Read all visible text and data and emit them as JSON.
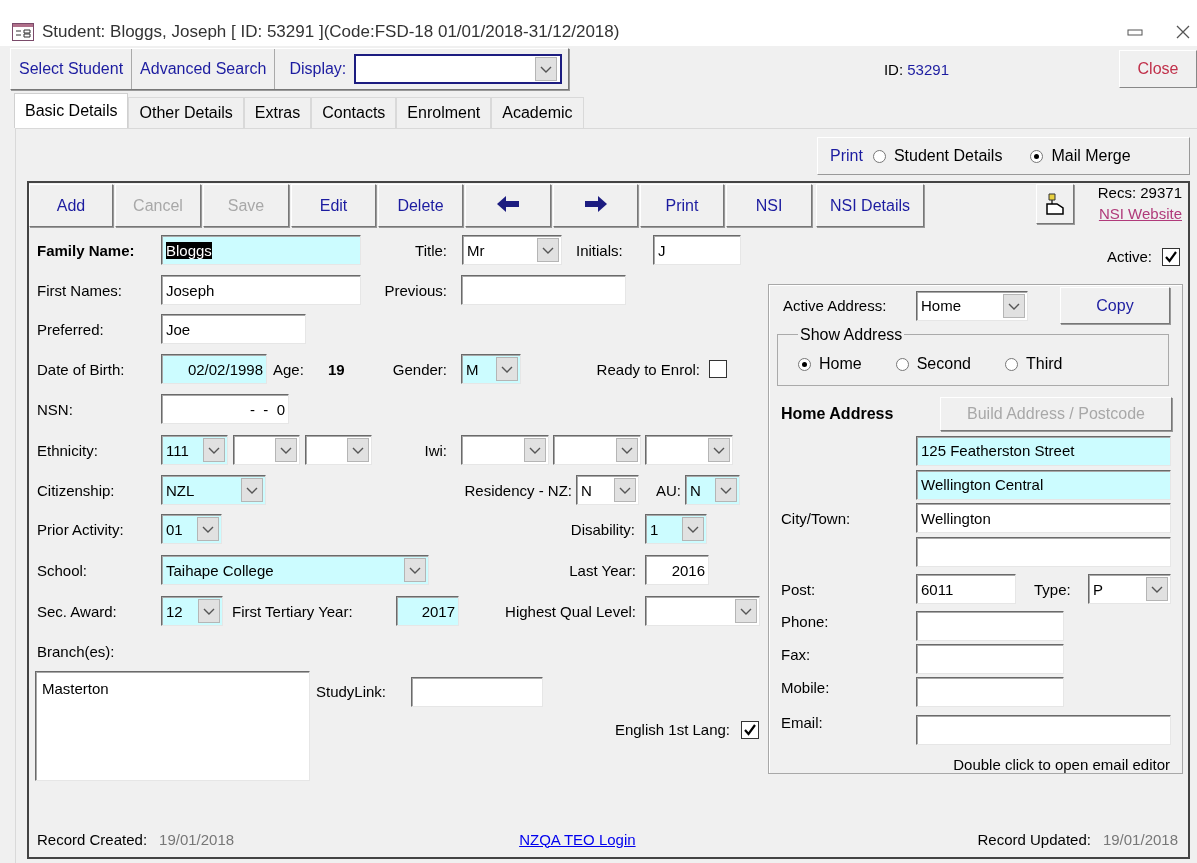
{
  "window": {
    "title": "Student: Bloggs, Joseph [ ID: 53291 ](Code:FSD-18 01/01/2018-31/12/2018)"
  },
  "toolbar": {
    "buttons": [
      "Select Student",
      "Advanced Search"
    ],
    "display_label": "Display:",
    "id_label": "ID:",
    "id_value": "53291",
    "close": "Close"
  },
  "tabs": [
    {
      "label": "Basic Details",
      "selected": true
    },
    {
      "label": "Other Details",
      "selected": false
    },
    {
      "label": "Extras",
      "selected": false
    },
    {
      "label": "Contacts",
      "selected": false
    },
    {
      "label": "Enrolment",
      "selected": false
    },
    {
      "label": "Academic",
      "selected": false
    }
  ],
  "print_options": {
    "label": "Print",
    "options": [
      {
        "label": "Student Details",
        "selected": false
      },
      {
        "label": "Mail Merge",
        "selected": true
      }
    ]
  },
  "record_buttons": [
    {
      "kind": "text",
      "label": "Add",
      "disabled": false
    },
    {
      "kind": "text",
      "label": "Cancel",
      "disabled": true
    },
    {
      "kind": "text",
      "label": "Save",
      "disabled": true
    },
    {
      "kind": "text",
      "label": "Edit",
      "disabled": false
    },
    {
      "kind": "text",
      "label": "Delete",
      "disabled": false
    },
    {
      "kind": "previous",
      "disabled": false
    },
    {
      "kind": "next",
      "disabled": false
    },
    {
      "kind": "text",
      "label": "Print",
      "disabled": false
    },
    {
      "kind": "text",
      "label": "NSI",
      "disabled": false
    },
    {
      "kind": "text",
      "label": "NSI Details",
      "disabled": false
    }
  ],
  "record_count": "Recs: 29371",
  "nsi_website": "NSI Website",
  "active": {
    "label": "Active:",
    "checked": true
  },
  "fields": [
    {
      "items": [
        {
          "kind": "label",
          "text": "Family Name:",
          "bold": true
        },
        {
          "kind": "text",
          "value": "Bloggs",
          "required": true,
          "text_highlighted": true
        },
        {
          "kind": "label",
          "text": "Title:"
        },
        {
          "kind": "combo",
          "value": "Mr",
          "required": false
        },
        {
          "kind": "label",
          "text": "Initials:"
        },
        {
          "kind": "text",
          "value": "J",
          "required": false
        }
      ]
    },
    {
      "items": [
        {
          "kind": "label",
          "text": "First Names:"
        },
        {
          "kind": "text",
          "value": "Joseph",
          "required": false
        },
        {
          "kind": "label",
          "text": "Previous:"
        },
        {
          "kind": "text",
          "required": false
        }
      ]
    },
    {
      "items": [
        {
          "kind": "label",
          "text": "Preferred:"
        },
        {
          "kind": "text",
          "value": "Joe",
          "required": false
        }
      ]
    },
    {
      "items": [
        {
          "kind": "label",
          "text": "Date of Birth:"
        },
        {
          "kind": "text",
          "value": "02/02/1998",
          "required": true
        },
        {
          "kind": "label",
          "text": "Age:"
        },
        {
          "kind": "value",
          "text": "19"
        },
        {
          "kind": "label",
          "text": "Gender:"
        },
        {
          "kind": "combo",
          "value": "M",
          "required": true
        },
        {
          "kind": "label",
          "text": "Ready to Enrol:"
        },
        {
          "kind": "check",
          "checked": false
        }
      ]
    },
    {
      "items": [
        {
          "kind": "label",
          "text": "NSN:"
        },
        {
          "kind": "text",
          "value": "-  -  0",
          "required": false
        }
      ]
    },
    {
      "items": [
        {
          "kind": "label",
          "text": "Ethnicity:"
        },
        {
          "kind": "combo",
          "value": "111",
          "required": true
        },
        {
          "kind": "combo",
          "required": false
        },
        {
          "kind": "combo",
          "required": false
        },
        {
          "kind": "label",
          "text": "Iwi:"
        },
        {
          "kind": "combo",
          "required": false
        },
        {
          "kind": "combo",
          "required": false
        },
        {
          "kind": "combo",
          "required": false
        }
      ]
    },
    {
      "items": [
        {
          "kind": "label",
          "text": "Citizenship:"
        },
        {
          "kind": "combo",
          "value": "NZL",
          "required": true
        },
        {
          "kind": "label",
          "text": "Residency - NZ:"
        },
        {
          "kind": "combo",
          "value": "N",
          "required": false
        },
        {
          "kind": "label",
          "text": "AU:"
        },
        {
          "kind": "combo",
          "value": "N",
          "required": true
        }
      ]
    },
    {
      "items": [
        {
          "kind": "label",
          "text": "Prior Activity:"
        },
        {
          "kind": "combo",
          "value": "01",
          "required": true
        },
        {
          "kind": "label",
          "text": "Disability:"
        },
        {
          "kind": "combo",
          "value": "1",
          "required": true
        }
      ]
    },
    {
      "items": [
        {
          "kind": "label",
          "text": "School:"
        },
        {
          "kind": "combo",
          "value": "Taihape College",
          "required": true
        },
        {
          "kind": "label",
          "text": "Last Year:"
        },
        {
          "kind": "text",
          "value": "2016",
          "required": false
        }
      ]
    },
    {
      "items": [
        {
          "kind": "label",
          "text": "Sec. Award:"
        },
        {
          "kind": "combo",
          "value": "12",
          "required": true
        },
        {
          "kind": "label",
          "text": "First Tertiary Year:"
        },
        {
          "kind": "text",
          "value": "2017",
          "required": true
        },
        {
          "kind": "label",
          "text": "Highest Qual Level:"
        },
        {
          "kind": "combo",
          "required": false
        }
      ]
    },
    {
      "items": [
        {
          "kind": "label",
          "text": "Branch(es):"
        }
      ]
    },
    {
      "items": [
        {
          "kind": "list",
          "entries": [
            "Masterton"
          ]
        },
        {
          "kind": "label",
          "text": "StudyLink:"
        },
        {
          "kind": "text",
          "required": false
        },
        {
          "kind": "label",
          "text": "English 1st Lang:"
        },
        {
          "kind": "check",
          "checked": true
        }
      ]
    }
  ],
  "address": {
    "active_label": "Active Address:",
    "active_value": "Home",
    "copy": "Copy",
    "show_label": "Show Address",
    "show_options": [
      {
        "label": "Home",
        "selected": true
      },
      {
        "label": "Second",
        "selected": false
      },
      {
        "label": "Third",
        "selected": false
      }
    ],
    "heading": "Home Address",
    "build_button": {
      "label": "Build Address / Postcode",
      "disabled": true
    },
    "lines": [
      {
        "value": "125 Featherston Street",
        "required": true
      },
      {
        "value": "Wellington Central",
        "required": true
      },
      {
        "label": "City/Town:",
        "value": "Wellington",
        "required": false
      },
      {
        "required": false
      }
    ],
    "post": {
      "label": "Post:",
      "value": "6011"
    },
    "type": {
      "label": "Type:",
      "value": "P"
    },
    "contacts": [
      {
        "label": "Phone:"
      },
      {
        "label": "Fax:"
      },
      {
        "label": "Mobile:"
      }
    ],
    "email": {
      "label": "Email:",
      "hint": "Double click to open email editor"
    }
  },
  "footer": {
    "created_label": "Record Created:",
    "created": "19/01/2018",
    "login_link": "NZQA TEO Login",
    "updated_label": "Record Updated:",
    "updated": "19/01/2018"
  }
}
